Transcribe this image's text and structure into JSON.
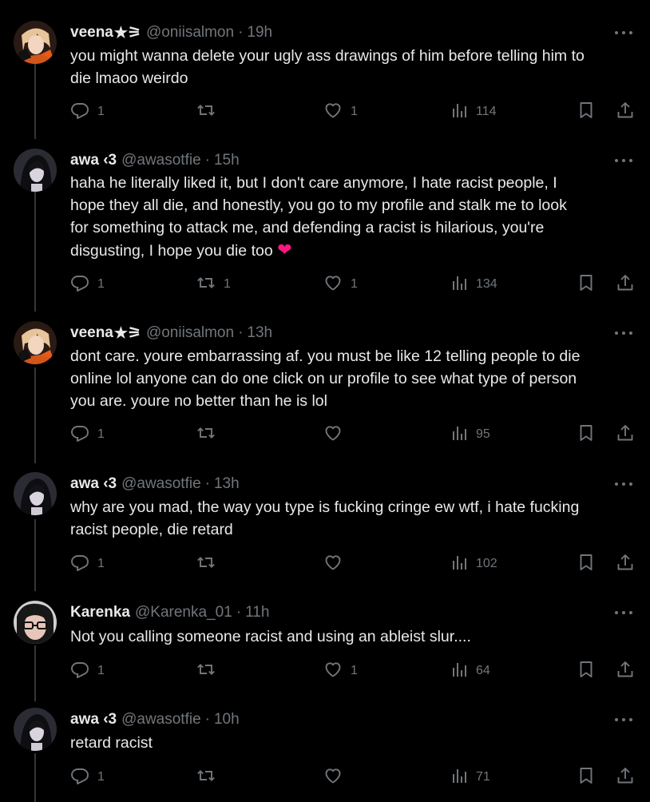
{
  "colors": {
    "background": "#000000",
    "text": "#e7e9ea",
    "muted": "#71767b",
    "heart": "#f91880",
    "thread_line": "#333639"
  },
  "icons": {
    "more": "more-icon",
    "reply": "reply-icon",
    "retweet": "retweet-icon",
    "like": "like-icon",
    "views": "views-icon",
    "bookmark": "bookmark-icon",
    "share": "share-icon"
  },
  "tweets": [
    {
      "name": "veena",
      "badge": "★⚞",
      "handle": "@oniisalmon",
      "sep": "·",
      "time": "19h",
      "lines": [
        "you might wanna delete your ugly ass drawings of him before telling him to",
        "die lmaoo weirdo"
      ],
      "replies": "1",
      "retweets": "",
      "likes": "1",
      "views": "114",
      "avatar": "blonde"
    },
    {
      "name": "awa ‹3",
      "badge": "",
      "handle": "@awasotfie",
      "sep": "·",
      "time": "15h",
      "lines": [
        "haha he literally liked it, but I don't care anymore, I hate racist people, I",
        "hope they all die, and honestly, you go to my profile and stalk me to look",
        "for something to attack me, and defending a racist is hilarious, you're",
        "disgusting, I hope you die too"
      ],
      "heart": "❤",
      "replies": "1",
      "retweets": "1",
      "likes": "1",
      "views": "134",
      "avatar": "dark"
    },
    {
      "name": "veena",
      "badge": "★⚞",
      "handle": "@oniisalmon",
      "sep": "·",
      "time": "13h",
      "lines": [
        "dont care. youre embarrassing af. you must be like 12 telling people to die",
        "online lol anyone can do one click on ur profile to see what type of person",
        "you are. youre no better than he is lol"
      ],
      "replies": "1",
      "retweets": "",
      "likes": "",
      "views": "95",
      "avatar": "blonde"
    },
    {
      "name": "awa ‹3",
      "badge": "",
      "handle": "@awasotfie",
      "sep": "·",
      "time": "13h",
      "lines": [
        "why are you mad, the way you type is fucking cringe ew wtf, i hate fucking",
        "racist people, die retard"
      ],
      "replies": "1",
      "retweets": "",
      "likes": "",
      "views": "102",
      "avatar": "dark"
    },
    {
      "name": "Karenka",
      "badge": "",
      "handle": "@Karenka_01",
      "sep": "·",
      "time": "11h",
      "lines": [
        "Not you calling someone racist and using an ableist slur...."
      ],
      "replies": "1",
      "retweets": "",
      "likes": "1",
      "views": "64",
      "avatar": "glasses"
    },
    {
      "name": "awa ‹3",
      "badge": "",
      "handle": "@awasotfie",
      "sep": "·",
      "time": "10h",
      "lines": [
        "retard racist"
      ],
      "replies": "1",
      "retweets": "",
      "likes": "",
      "views": "71",
      "avatar": "dark"
    }
  ]
}
